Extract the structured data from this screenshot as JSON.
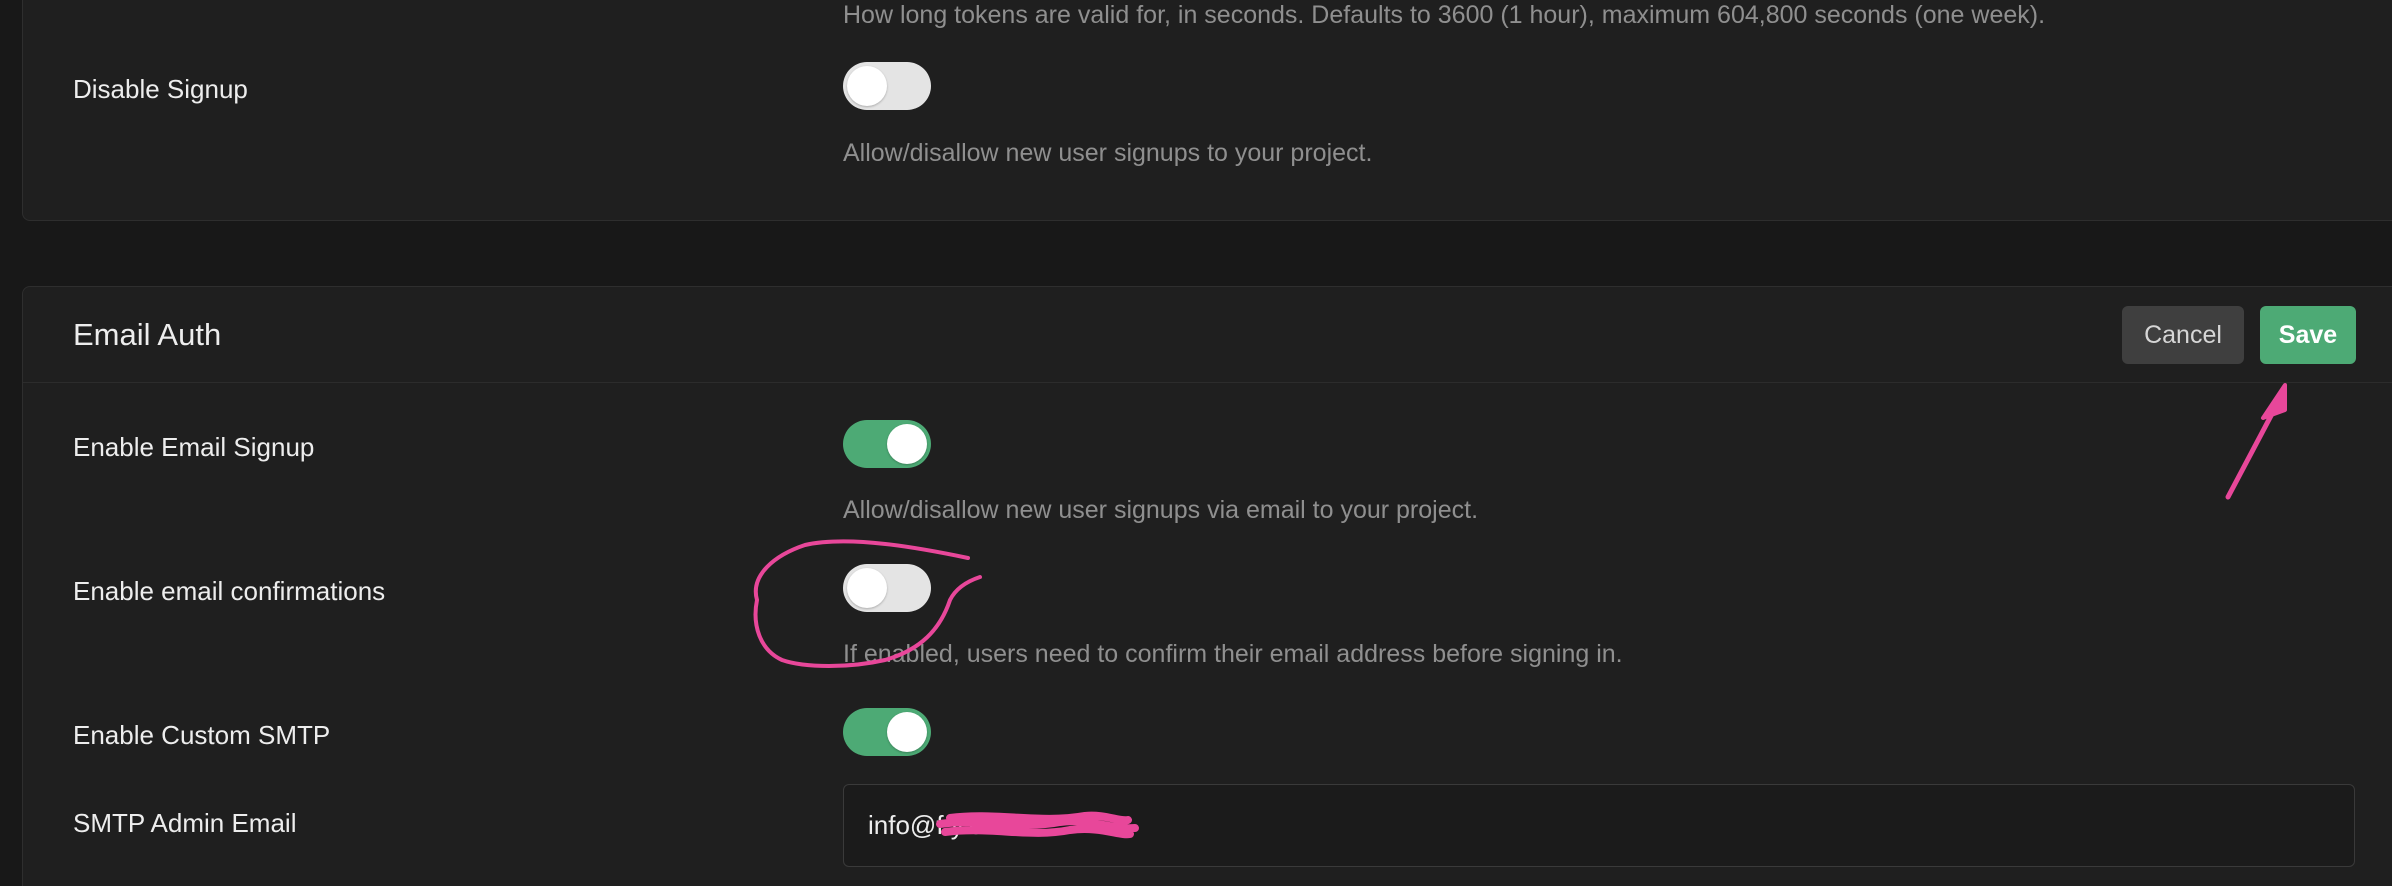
{
  "top_section": {
    "token_description": "How long tokens are valid for, in seconds. Defaults to 3600 (1 hour), maximum 604,800 seconds (one week).",
    "disable_signup": {
      "label": "Disable Signup",
      "enabled": false,
      "description": "Allow/disallow new user signups to your project."
    }
  },
  "email_auth": {
    "title": "Email Auth",
    "cancel_label": "Cancel",
    "save_label": "Save",
    "enable_email_signup": {
      "label": "Enable Email Signup",
      "enabled": true,
      "description": "Allow/disallow new user signups via email to your project."
    },
    "enable_email_confirmations": {
      "label": "Enable email confirmations",
      "enabled": false,
      "description": "If enabled, users need to confirm their email address before signing in."
    },
    "enable_custom_smtp": {
      "label": "Enable Custom SMTP",
      "enabled": true
    },
    "smtp_admin_email": {
      "label": "SMTP Admin Email",
      "value": "info@f                   y.com"
    }
  },
  "colors": {
    "accent_green": "#4daa75",
    "annotation_pink": "#e8479a",
    "background": "#181818",
    "panel": "#1f1f1f"
  }
}
